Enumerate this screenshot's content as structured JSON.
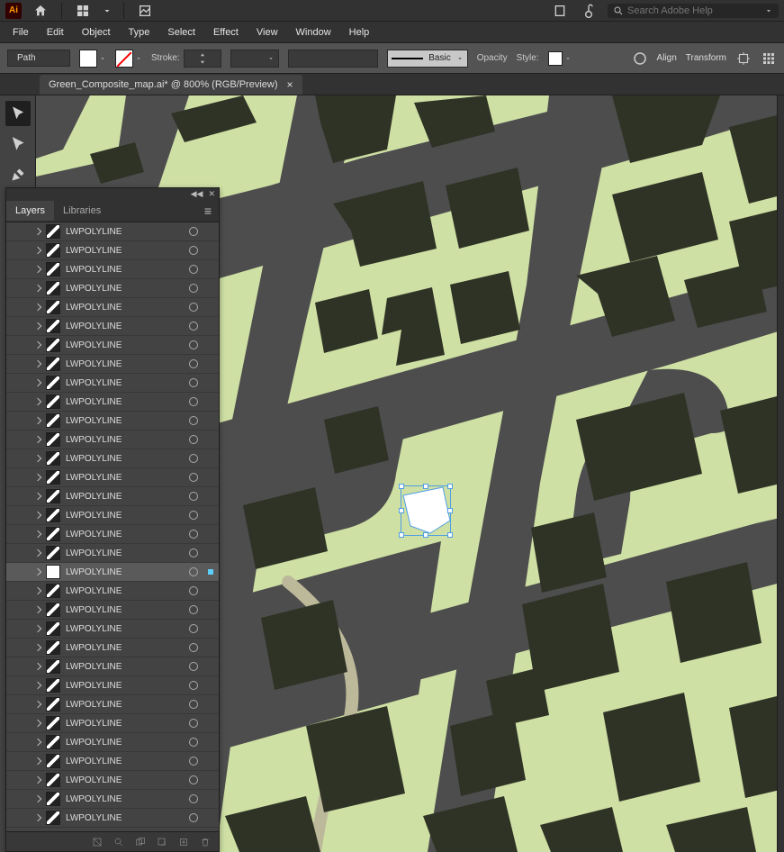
{
  "appbar": {
    "product_badge": "Ai",
    "search_placeholder": "Search Adobe Help"
  },
  "menubar": [
    "File",
    "Edit",
    "Object",
    "Type",
    "Select",
    "Effect",
    "View",
    "Window",
    "Help"
  ],
  "ctrlbar": {
    "selection_type": "Path",
    "stroke_label": "Stroke:",
    "stroke_profile": "Basic",
    "opacity_label": "Opacity",
    "style_label": "Style:",
    "align_label": "Align",
    "transform_label": "Transform"
  },
  "doc_tab": {
    "title": "Green_Composite_map.ai* @ 800% (RGB/Preview)"
  },
  "layers_panel": {
    "tabs": [
      "Layers",
      "Libraries"
    ],
    "active_tab": 0,
    "item_label": "LWPOLYLINE",
    "item_count": 32,
    "selected_index": 18
  },
  "canvas": {
    "bg": "#cfe0a4",
    "road": "#4d4d4d",
    "building": "#2f3326",
    "selected_fill": "#ffffff"
  }
}
